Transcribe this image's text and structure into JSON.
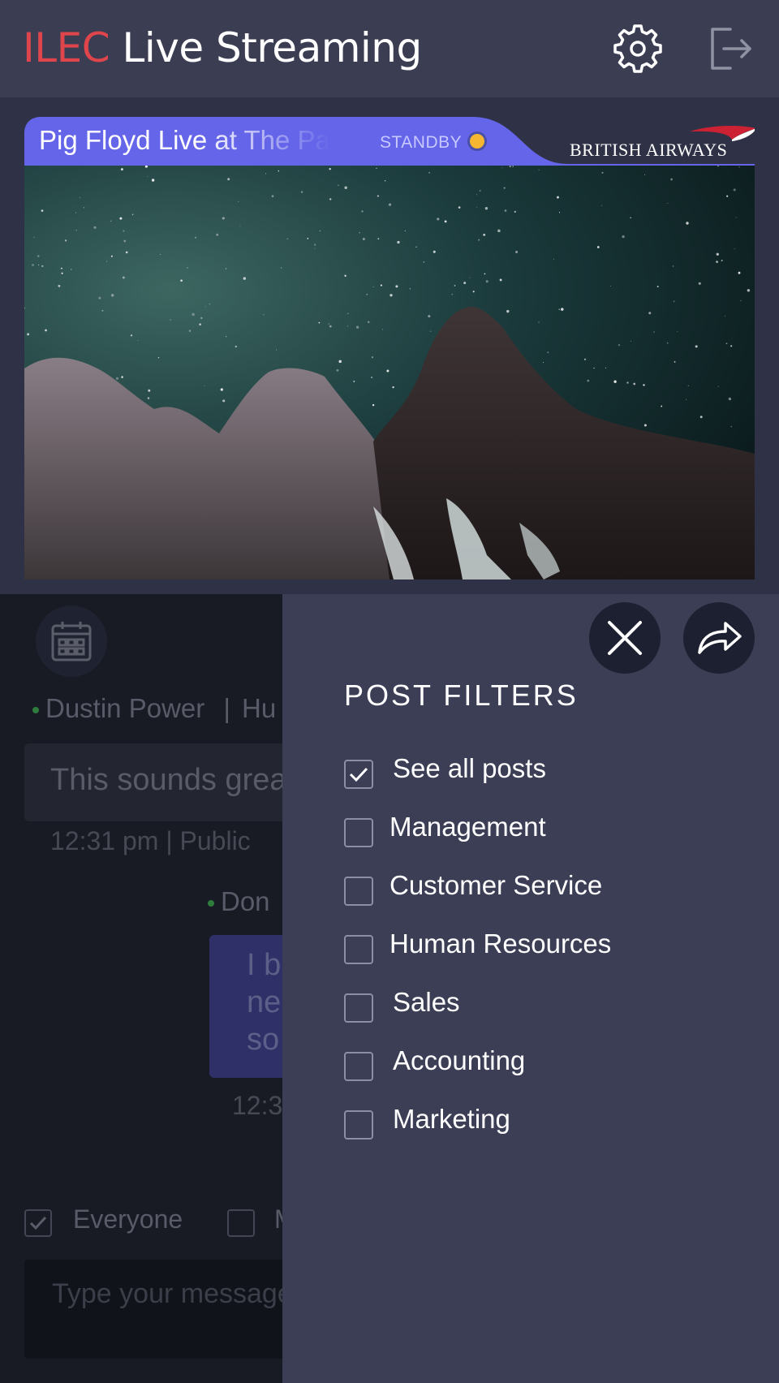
{
  "header": {
    "brand_accent": "ILEC",
    "brand_rest": "Live Streaming",
    "settings_icon": "gear-icon",
    "logout_icon": "logout-icon"
  },
  "stream": {
    "title": "Pig Floyd Live at The Pa",
    "status": "STANDBY",
    "sponsor": "BRITISH AIRWAYS"
  },
  "chat": {
    "messages": [
      {
        "author": "Dustin Power",
        "separator": "|",
        "department": "Hu",
        "text": "This sounds grea",
        "meta": "12:31 pm | Public"
      },
      {
        "author": "Don",
        "lines": "I b\nne\nso",
        "meta": "12:3"
      }
    ],
    "audience_everyone": "Everyone",
    "audience_other": "M",
    "compose_placeholder": "Type your message"
  },
  "filters_panel": {
    "title": "POST FILTERS",
    "items": [
      {
        "label": "See all posts",
        "checked": true
      },
      {
        "label": "Management",
        "checked": false
      },
      {
        "label": "Customer Service",
        "checked": false
      },
      {
        "label": "Human Resources",
        "checked": false
      },
      {
        "label": "Sales",
        "checked": false
      },
      {
        "label": "Accounting",
        "checked": false
      },
      {
        "label": "Marketing",
        "checked": false
      }
    ]
  },
  "colors": {
    "brand_accent": "#e0454c",
    "header_bg": "#3b3e53",
    "title_bar": "#6565e9",
    "panel_bg": "#3b3e55",
    "standby_dot": "#f5b731"
  }
}
